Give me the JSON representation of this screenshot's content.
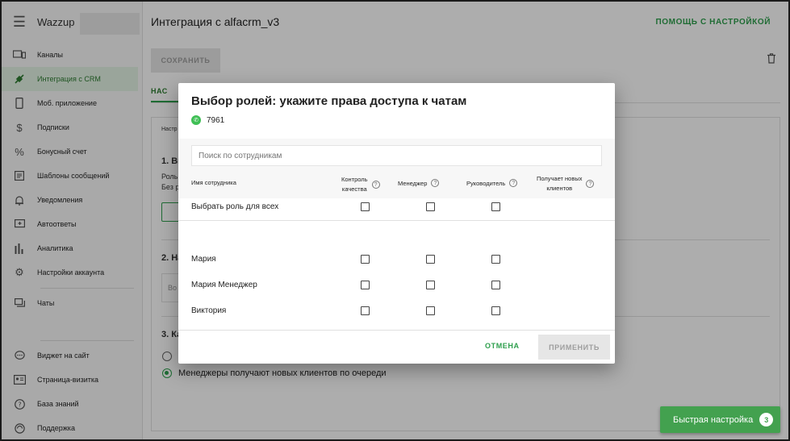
{
  "sidebar": {
    "brand": "Wazzup",
    "items": [
      {
        "label": "Каналы",
        "icon": "channels-icon"
      },
      {
        "label": "Интеграция с CRM",
        "icon": "plug-icon"
      },
      {
        "label": "Моб. приложение",
        "icon": "phone-icon"
      },
      {
        "label": "Подписки",
        "icon": "dollar-icon"
      },
      {
        "label": "Бонусный счет",
        "icon": "percent-icon"
      },
      {
        "label": "Шаблоны сообщений",
        "icon": "template-icon"
      },
      {
        "label": "Уведомления",
        "icon": "bell-icon"
      },
      {
        "label": "Автоответы",
        "icon": "autoreply-icon"
      },
      {
        "label": "Аналитика",
        "icon": "analytics-icon"
      },
      {
        "label": "Настройки аккаунта",
        "icon": "gear-icon"
      },
      {
        "label": "Чаты",
        "icon": "chat-icon"
      },
      {
        "label": "Виджет на сайт",
        "icon": "widget-icon"
      },
      {
        "label": "Страница-визитка",
        "icon": "card-icon"
      },
      {
        "label": "База знаний",
        "icon": "help-icon"
      },
      {
        "label": "Поддержка",
        "icon": "support-icon"
      }
    ]
  },
  "header": {
    "title": "Интеграция с alfacrm_v3",
    "help": "ПОМОЩЬ С НАСТРОЙКОЙ"
  },
  "page": {
    "save": "СОХРАНИТЬ",
    "tab": "НАС",
    "card_top": "Настр",
    "section1": "1. Вы",
    "section1_line1": "Роль",
    "section1_line2": "Без р",
    "section2": "2. На",
    "section2_input": "Во",
    "section3": "3. Ка",
    "radio2": "Менеджеры получают новых клиентов по очереди"
  },
  "modal": {
    "title": "Выбор ролей: укажите права доступа к чатам",
    "channel": "7961",
    "search_placeholder": "Поиск по сотрудникам",
    "col_name": "Имя сотрудника",
    "col1_line1": "Контроль",
    "col1_line2": "качества",
    "col2": "Менеджер",
    "col3": "Руководитель",
    "col4_line1": "Получает новых",
    "col4_line2": "клиентов",
    "select_all": "Выбрать роль для всех",
    "employees": [
      "Мария",
      "Мария Менеджер",
      "Виктория"
    ],
    "cancel": "ОТМЕНА",
    "apply": "ПРИМЕНИТЬ"
  },
  "quick_setup": {
    "label": "Быстрая настройка",
    "badge": "3"
  },
  "colors": {
    "accent": "#2e9f4d",
    "active_bg": "#e3f3e5",
    "quick_bg": "#43a14f"
  }
}
